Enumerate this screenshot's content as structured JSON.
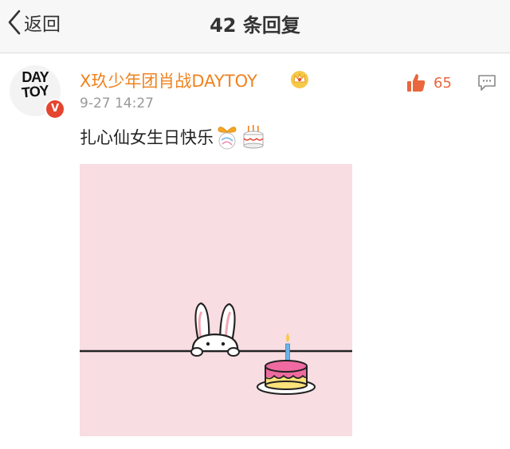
{
  "nav": {
    "back_label": "返回",
    "title": "42 条回复"
  },
  "comment": {
    "avatar_text_line1": "DAY",
    "avatar_text_line2": "TOY",
    "verified_mark": "V",
    "username": "X玖少年团肖战DAYTOY",
    "time": "9-27 14:27",
    "likes": "65",
    "text": "扎心仙女生日快乐"
  },
  "colors": {
    "username": "#f0821e",
    "like": "#e8673c",
    "badge": "#e5442f",
    "image_background": "#f8dde2"
  },
  "icons": [
    "back-chevron-icon",
    "crown-icon",
    "thumbs-up-icon",
    "comment-icon",
    "ribbon-emoji-icon",
    "cake-emoji-icon"
  ]
}
